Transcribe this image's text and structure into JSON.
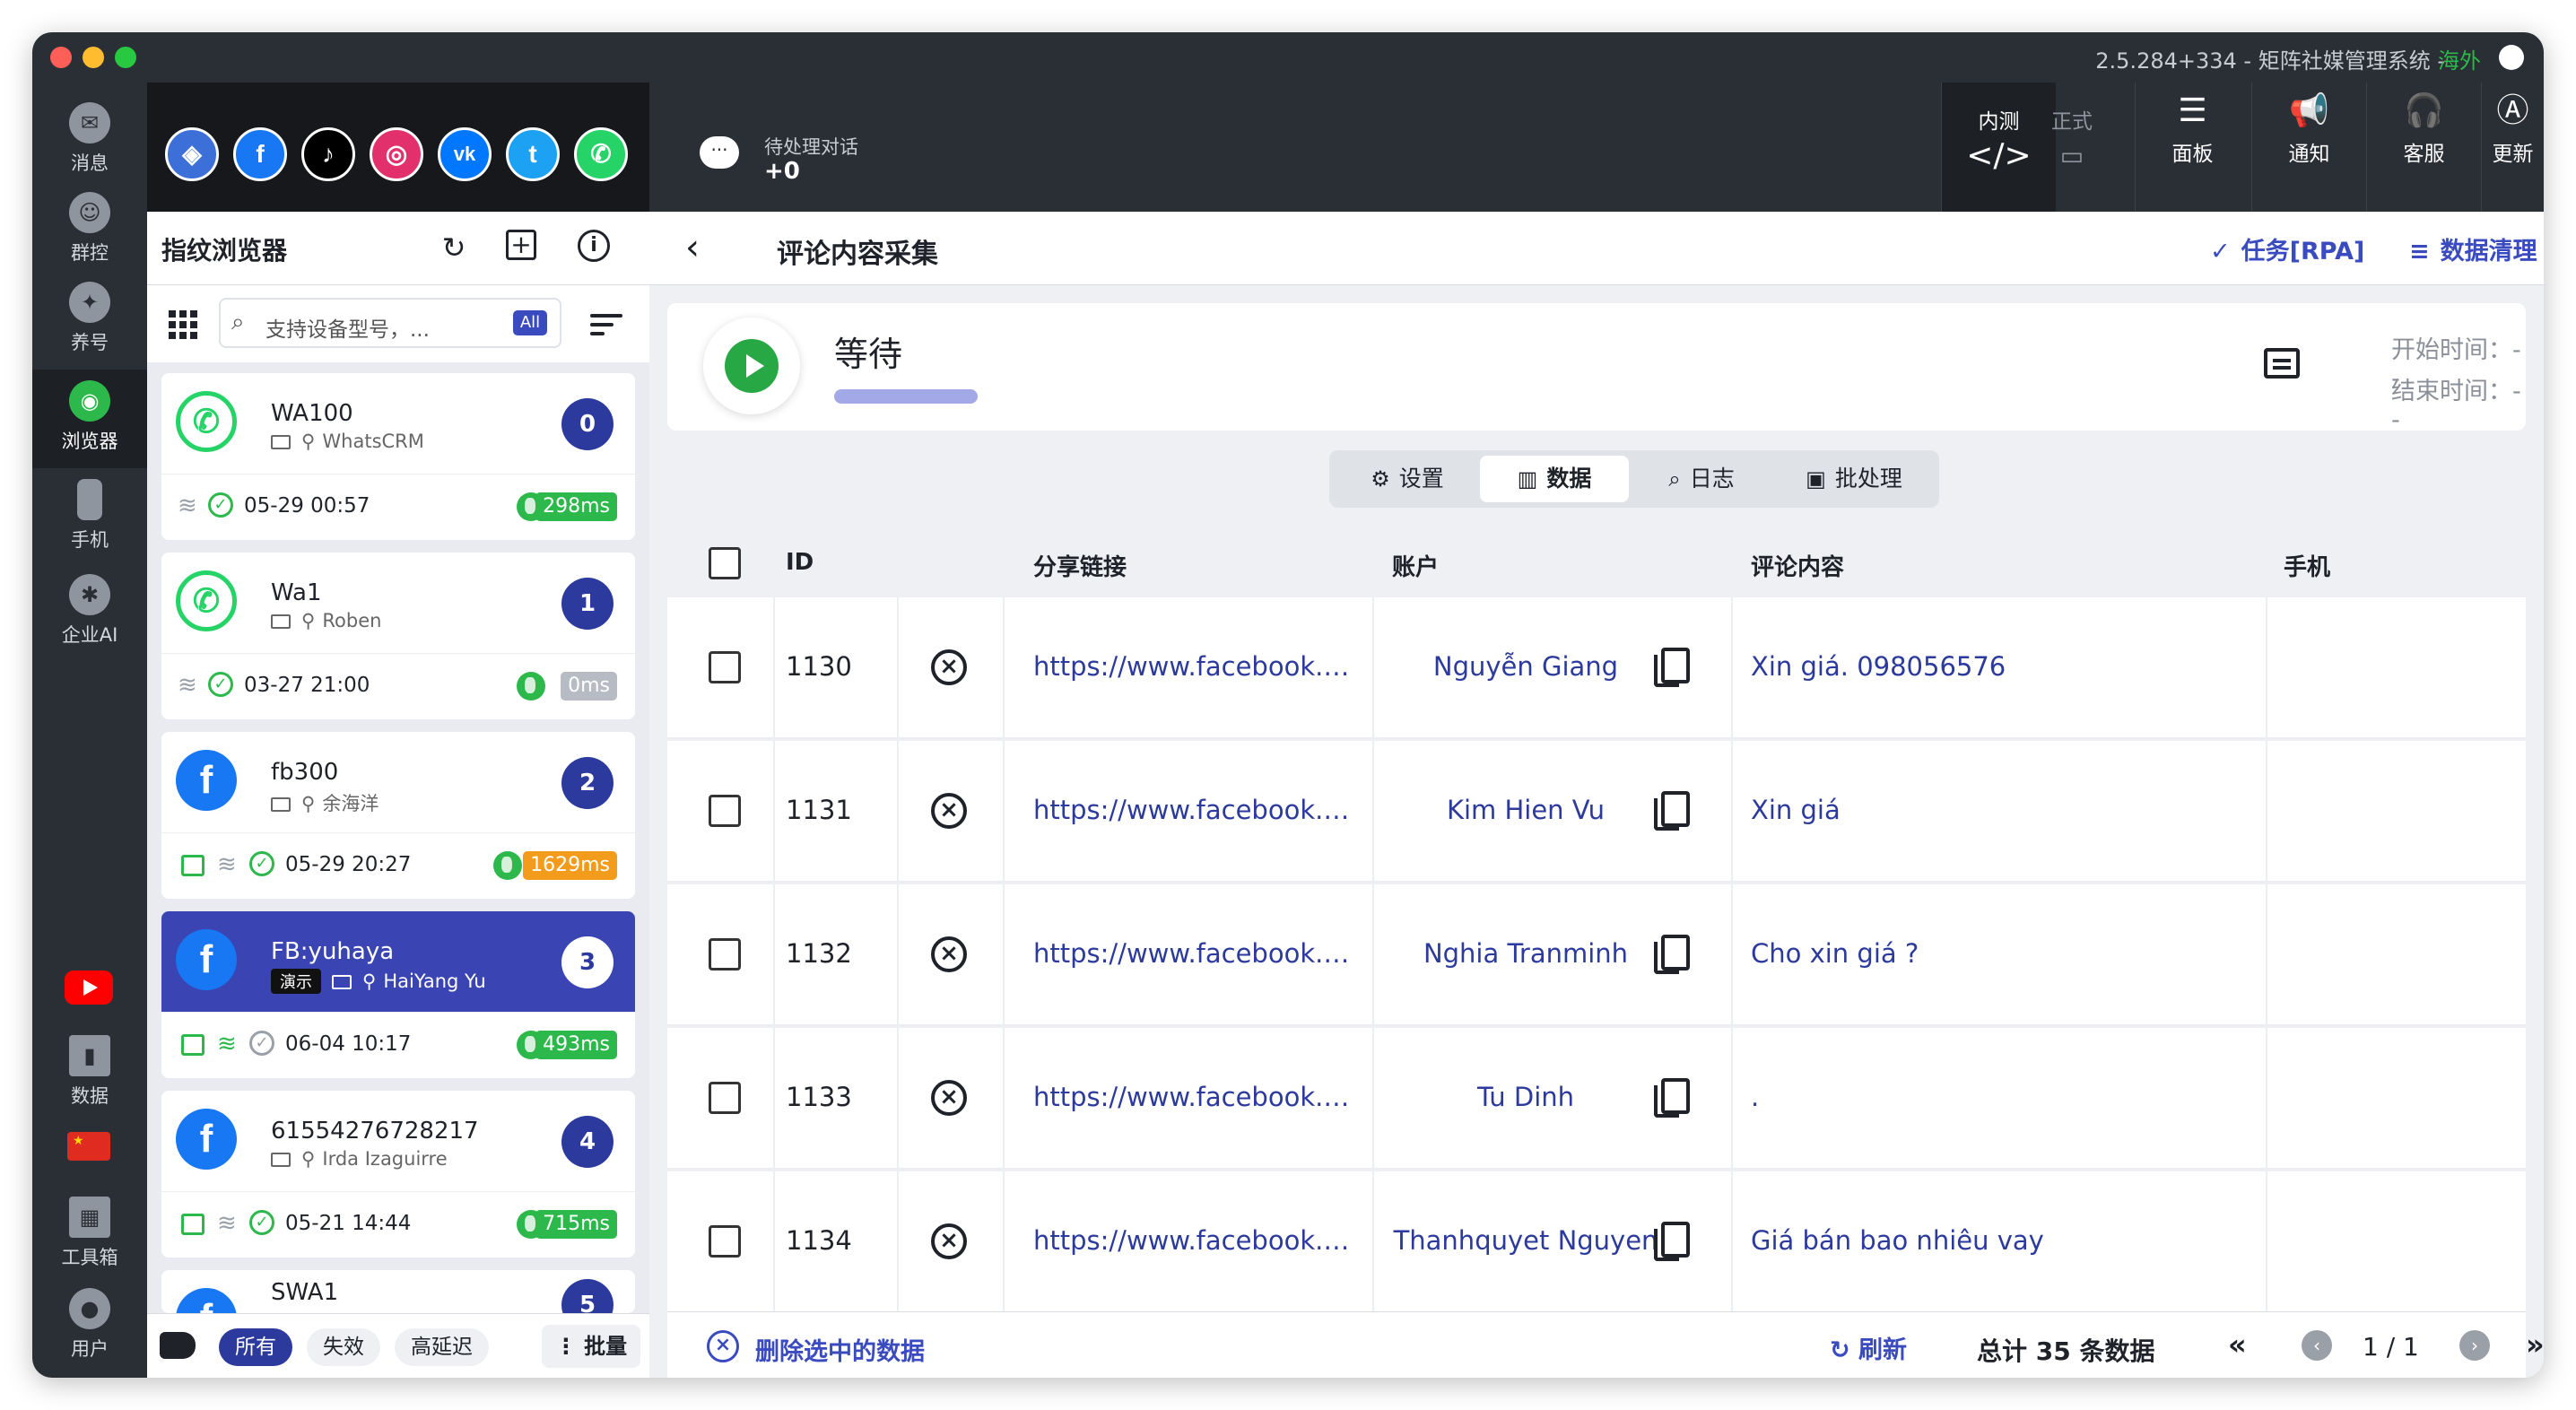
{
  "window": {
    "version": "2.5.284+334 - 矩阵社媒管理系统 -",
    "region": "海外"
  },
  "nav": {
    "items": [
      {
        "label": "消息",
        "icon": "message-icon"
      },
      {
        "label": "群控",
        "icon": "group-control-icon"
      },
      {
        "label": "养号",
        "icon": "account-nurture-icon"
      },
      {
        "label": "浏览器",
        "icon": "browser-icon"
      },
      {
        "label": "手机",
        "icon": "phone-icon"
      },
      {
        "label": "企业AI",
        "icon": "ai-brain-icon"
      },
      {
        "label": "数据",
        "icon": "bar-chart-icon"
      },
      {
        "label": "工具箱",
        "icon": "toolbox-icon"
      },
      {
        "label": "用户",
        "icon": "user-icon"
      }
    ],
    "youtube_icon": "youtube-icon",
    "flag_icon": "china-flag-icon"
  },
  "social": [
    {
      "name": "browser",
      "glyph": "◈",
      "color": "#3d6fd8"
    },
    {
      "name": "facebook",
      "glyph": "f",
      "color": "#1877f2"
    },
    {
      "name": "tiktok",
      "glyph": "♪",
      "color": "#000000"
    },
    {
      "name": "instagram",
      "glyph": "◎",
      "color": "#e1306c"
    },
    {
      "name": "vk",
      "glyph": "vk",
      "color": "#0077ff"
    },
    {
      "name": "twitter",
      "glyph": "t",
      "color": "#1da1f2"
    },
    {
      "name": "whatsapp",
      "glyph": "✆",
      "color": "#25d366"
    }
  ],
  "topbar": {
    "pending_label": "待处理对话",
    "pending_count": "+0",
    "env_test": "内测",
    "env_formal": "正式",
    "buttons": [
      {
        "label": "面板",
        "icon": "sliders-icon"
      },
      {
        "label": "通知",
        "icon": "megaphone-icon"
      },
      {
        "label": "客服",
        "icon": "headset-icon"
      },
      {
        "label": "更新",
        "icon": "app-store-icon"
      }
    ]
  },
  "left_panel": {
    "title": "指纹浏览器",
    "search_placeholder": "支持设备型号，...",
    "search_badge": "All",
    "cards": [
      {
        "name": "WA100",
        "user": "WhatsCRM",
        "num": "0",
        "time": "05-29 00:57",
        "latency": "298ms",
        "latency_color": "green",
        "platform": "whatsapp",
        "store": false,
        "wifi_on": false
      },
      {
        "name": "Wa1",
        "user": "Roben",
        "num": "1",
        "time": "03-27 21:00",
        "latency": "0ms",
        "latency_color": "grey",
        "platform": "whatsapp",
        "store": false,
        "wifi_on": false
      },
      {
        "name": "fb300",
        "user": "余海洋",
        "num": "2",
        "time": "05-29 20:27",
        "latency": "1629ms",
        "latency_color": "orange",
        "platform": "facebook",
        "store": true,
        "wifi_on": false
      },
      {
        "name": "FB:yuhaya",
        "user": "HaiYang Yu",
        "num": "3",
        "time": "06-04 10:17",
        "latency": "493ms",
        "latency_color": "green",
        "platform": "facebook",
        "store": true,
        "wifi_on": true,
        "demo": "演示"
      },
      {
        "name": "61554276728217",
        "user": "Irda Izaguirre",
        "num": "4",
        "time": "05-21 14:44",
        "latency": "715ms",
        "latency_color": "green",
        "platform": "facebook",
        "store": true,
        "wifi_on": false
      },
      {
        "name": "SWA1",
        "user": "",
        "num": "5",
        "time": "",
        "latency": "",
        "platform": "facebook"
      }
    ],
    "filters": [
      "所有",
      "失效",
      "高延迟"
    ],
    "batch": "批量"
  },
  "main": {
    "title": "评论内容采集",
    "task_link": "任务[RPA]",
    "clean_link": "数据清理",
    "status": "等待",
    "start_time": "开始时间：--",
    "end_time": "结束时间：--",
    "tabs": [
      {
        "label": "设置",
        "icon": "gear-icon"
      },
      {
        "label": "数据",
        "icon": "chart-icon"
      },
      {
        "label": "日志",
        "icon": "search-log-icon"
      },
      {
        "label": "批处理",
        "icon": "save-icon"
      }
    ],
    "columns": [
      "ID",
      "分享链接",
      "账户",
      "评论内容",
      "手机"
    ],
    "rows": [
      {
        "id": "1130",
        "link": "https://www.facebook.com/...",
        "account": "Nguyễn Giang",
        "comment": "Xin giá. 098056576"
      },
      {
        "id": "1131",
        "link": "https://www.facebook.com/...",
        "account": "Kim Hien Vu",
        "comment": "Xin giá"
      },
      {
        "id": "1132",
        "link": "https://www.facebook.com/...",
        "account": "Nghia Tranminh",
        "comment": "Cho xin giá ?"
      },
      {
        "id": "1133",
        "link": "https://www.facebook.com/...",
        "account": "Tu Dinh",
        "comment": "."
      },
      {
        "id": "1134",
        "link": "https://www.facebook.com/...",
        "account": "Thanhquyet Nguyen",
        "comment": "Giá bán bao nhiêu vay"
      }
    ],
    "delete_selected": "删除选中的数据",
    "refresh": "刷新",
    "total": "总计 35 条数据",
    "page": "1 / 1"
  }
}
